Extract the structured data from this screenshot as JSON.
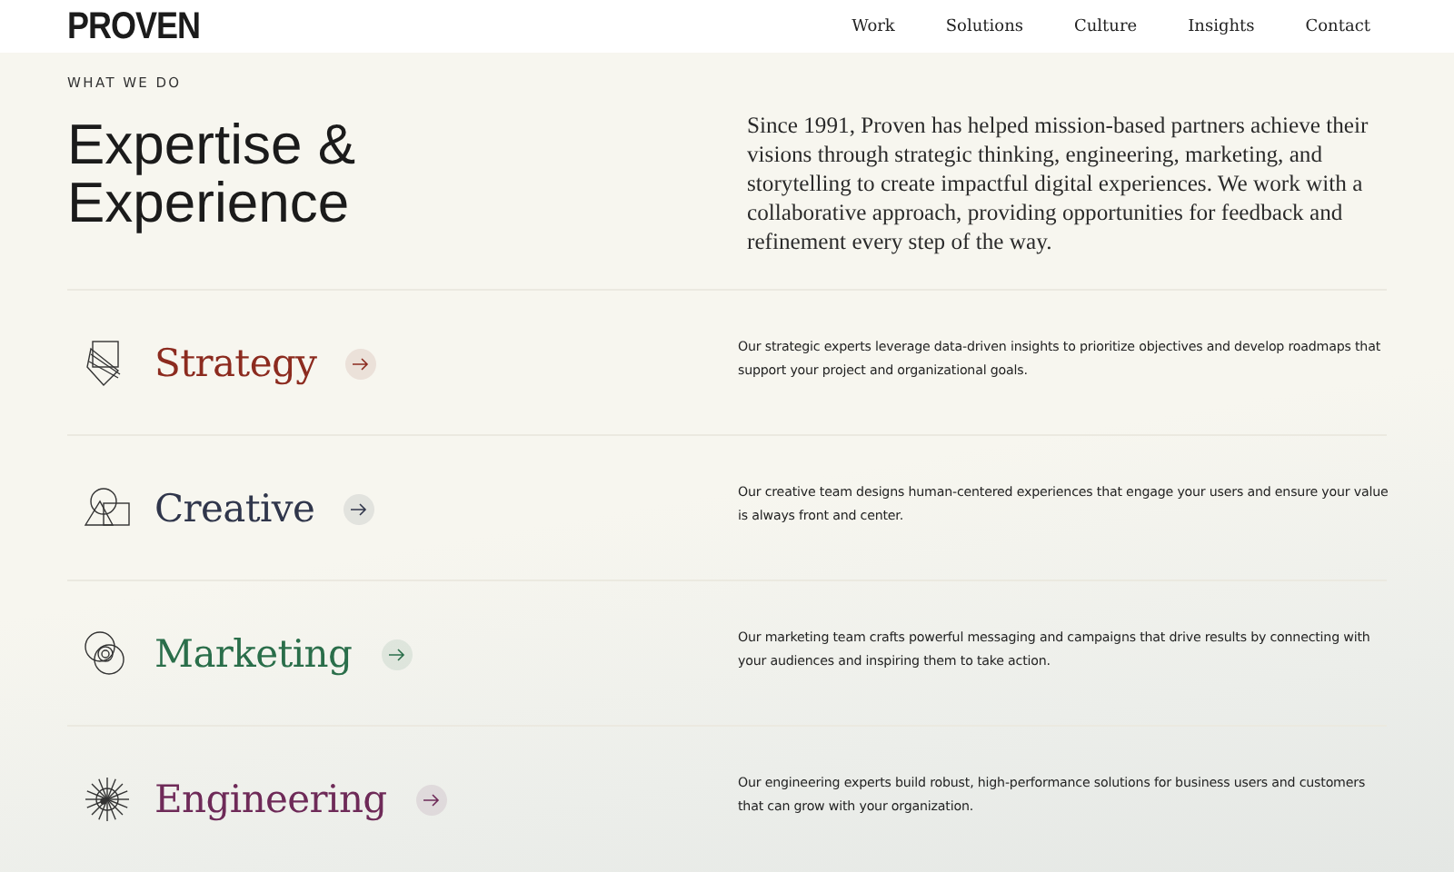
{
  "header": {
    "logo": "PROVEN",
    "nav": [
      "Work",
      "Solutions",
      "Culture",
      "Insights",
      "Contact"
    ]
  },
  "intro": {
    "eyebrow": "WHAT WE DO",
    "heading": "Expertise & Experience",
    "text": "Since 1991, Proven has helped mission-based partners achieve their visions through strategic thinking, engineering, marketing, and storytelling to create impactful digital experiences. We work with a collaborative approach, providing opportunities for feedback and refinement every step of the way."
  },
  "services": [
    {
      "kind": "papers",
      "title": "Strategy",
      "color": "#8c2b1f",
      "text": "Our strategic experts leverage data-driven insights to prioritize objectives and develop roadmaps that support your project and organizational goals."
    },
    {
      "kind": "shapes",
      "title": "Creative",
      "color": "#30364b",
      "text": "Our creative team designs human-centered experiences that engage your users and ensure your value is always front and center."
    },
    {
      "kind": "circles",
      "title": "Marketing",
      "color": "#2a6e4a",
      "text": "Our marketing team crafts powerful messaging and campaigns that drive results by connecting with your audiences and inspiring them to take action."
    },
    {
      "kind": "burst",
      "title": "Engineering",
      "color": "#6e2a58",
      "text": "Our engineering experts build robust, high-performance solutions for business users and customers that can grow with your organization."
    }
  ]
}
